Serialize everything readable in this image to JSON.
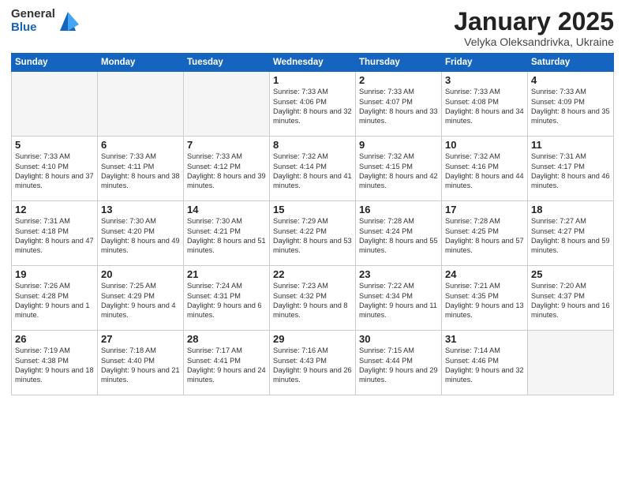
{
  "logo": {
    "general": "General",
    "blue": "Blue"
  },
  "header": {
    "month": "January 2025",
    "location": "Velyka Oleksandrivka, Ukraine"
  },
  "weekdays": [
    "Sunday",
    "Monday",
    "Tuesday",
    "Wednesday",
    "Thursday",
    "Friday",
    "Saturday"
  ],
  "weeks": [
    [
      {
        "day": "",
        "info": "",
        "empty": true
      },
      {
        "day": "",
        "info": "",
        "empty": true
      },
      {
        "day": "",
        "info": "",
        "empty": true
      },
      {
        "day": "1",
        "info": "Sunrise: 7:33 AM\nSunset: 4:06 PM\nDaylight: 8 hours\nand 32 minutes."
      },
      {
        "day": "2",
        "info": "Sunrise: 7:33 AM\nSunset: 4:07 PM\nDaylight: 8 hours\nand 33 minutes."
      },
      {
        "day": "3",
        "info": "Sunrise: 7:33 AM\nSunset: 4:08 PM\nDaylight: 8 hours\nand 34 minutes."
      },
      {
        "day": "4",
        "info": "Sunrise: 7:33 AM\nSunset: 4:09 PM\nDaylight: 8 hours\nand 35 minutes."
      }
    ],
    [
      {
        "day": "5",
        "info": "Sunrise: 7:33 AM\nSunset: 4:10 PM\nDaylight: 8 hours\nand 37 minutes."
      },
      {
        "day": "6",
        "info": "Sunrise: 7:33 AM\nSunset: 4:11 PM\nDaylight: 8 hours\nand 38 minutes."
      },
      {
        "day": "7",
        "info": "Sunrise: 7:33 AM\nSunset: 4:12 PM\nDaylight: 8 hours\nand 39 minutes."
      },
      {
        "day": "8",
        "info": "Sunrise: 7:32 AM\nSunset: 4:14 PM\nDaylight: 8 hours\nand 41 minutes."
      },
      {
        "day": "9",
        "info": "Sunrise: 7:32 AM\nSunset: 4:15 PM\nDaylight: 8 hours\nand 42 minutes."
      },
      {
        "day": "10",
        "info": "Sunrise: 7:32 AM\nSunset: 4:16 PM\nDaylight: 8 hours\nand 44 minutes."
      },
      {
        "day": "11",
        "info": "Sunrise: 7:31 AM\nSunset: 4:17 PM\nDaylight: 8 hours\nand 46 minutes."
      }
    ],
    [
      {
        "day": "12",
        "info": "Sunrise: 7:31 AM\nSunset: 4:18 PM\nDaylight: 8 hours\nand 47 minutes."
      },
      {
        "day": "13",
        "info": "Sunrise: 7:30 AM\nSunset: 4:20 PM\nDaylight: 8 hours\nand 49 minutes."
      },
      {
        "day": "14",
        "info": "Sunrise: 7:30 AM\nSunset: 4:21 PM\nDaylight: 8 hours\nand 51 minutes."
      },
      {
        "day": "15",
        "info": "Sunrise: 7:29 AM\nSunset: 4:22 PM\nDaylight: 8 hours\nand 53 minutes."
      },
      {
        "day": "16",
        "info": "Sunrise: 7:28 AM\nSunset: 4:24 PM\nDaylight: 8 hours\nand 55 minutes."
      },
      {
        "day": "17",
        "info": "Sunrise: 7:28 AM\nSunset: 4:25 PM\nDaylight: 8 hours\nand 57 minutes."
      },
      {
        "day": "18",
        "info": "Sunrise: 7:27 AM\nSunset: 4:27 PM\nDaylight: 8 hours\nand 59 minutes."
      }
    ],
    [
      {
        "day": "19",
        "info": "Sunrise: 7:26 AM\nSunset: 4:28 PM\nDaylight: 9 hours\nand 1 minute."
      },
      {
        "day": "20",
        "info": "Sunrise: 7:25 AM\nSunset: 4:29 PM\nDaylight: 9 hours\nand 4 minutes."
      },
      {
        "day": "21",
        "info": "Sunrise: 7:24 AM\nSunset: 4:31 PM\nDaylight: 9 hours\nand 6 minutes."
      },
      {
        "day": "22",
        "info": "Sunrise: 7:23 AM\nSunset: 4:32 PM\nDaylight: 9 hours\nand 8 minutes."
      },
      {
        "day": "23",
        "info": "Sunrise: 7:22 AM\nSunset: 4:34 PM\nDaylight: 9 hours\nand 11 minutes."
      },
      {
        "day": "24",
        "info": "Sunrise: 7:21 AM\nSunset: 4:35 PM\nDaylight: 9 hours\nand 13 minutes."
      },
      {
        "day": "25",
        "info": "Sunrise: 7:20 AM\nSunset: 4:37 PM\nDaylight: 9 hours\nand 16 minutes."
      }
    ],
    [
      {
        "day": "26",
        "info": "Sunrise: 7:19 AM\nSunset: 4:38 PM\nDaylight: 9 hours\nand 18 minutes."
      },
      {
        "day": "27",
        "info": "Sunrise: 7:18 AM\nSunset: 4:40 PM\nDaylight: 9 hours\nand 21 minutes."
      },
      {
        "day": "28",
        "info": "Sunrise: 7:17 AM\nSunset: 4:41 PM\nDaylight: 9 hours\nand 24 minutes."
      },
      {
        "day": "29",
        "info": "Sunrise: 7:16 AM\nSunset: 4:43 PM\nDaylight: 9 hours\nand 26 minutes."
      },
      {
        "day": "30",
        "info": "Sunrise: 7:15 AM\nSunset: 4:44 PM\nDaylight: 9 hours\nand 29 minutes."
      },
      {
        "day": "31",
        "info": "Sunrise: 7:14 AM\nSunset: 4:46 PM\nDaylight: 9 hours\nand 32 minutes."
      },
      {
        "day": "",
        "info": "",
        "empty": true
      }
    ]
  ]
}
